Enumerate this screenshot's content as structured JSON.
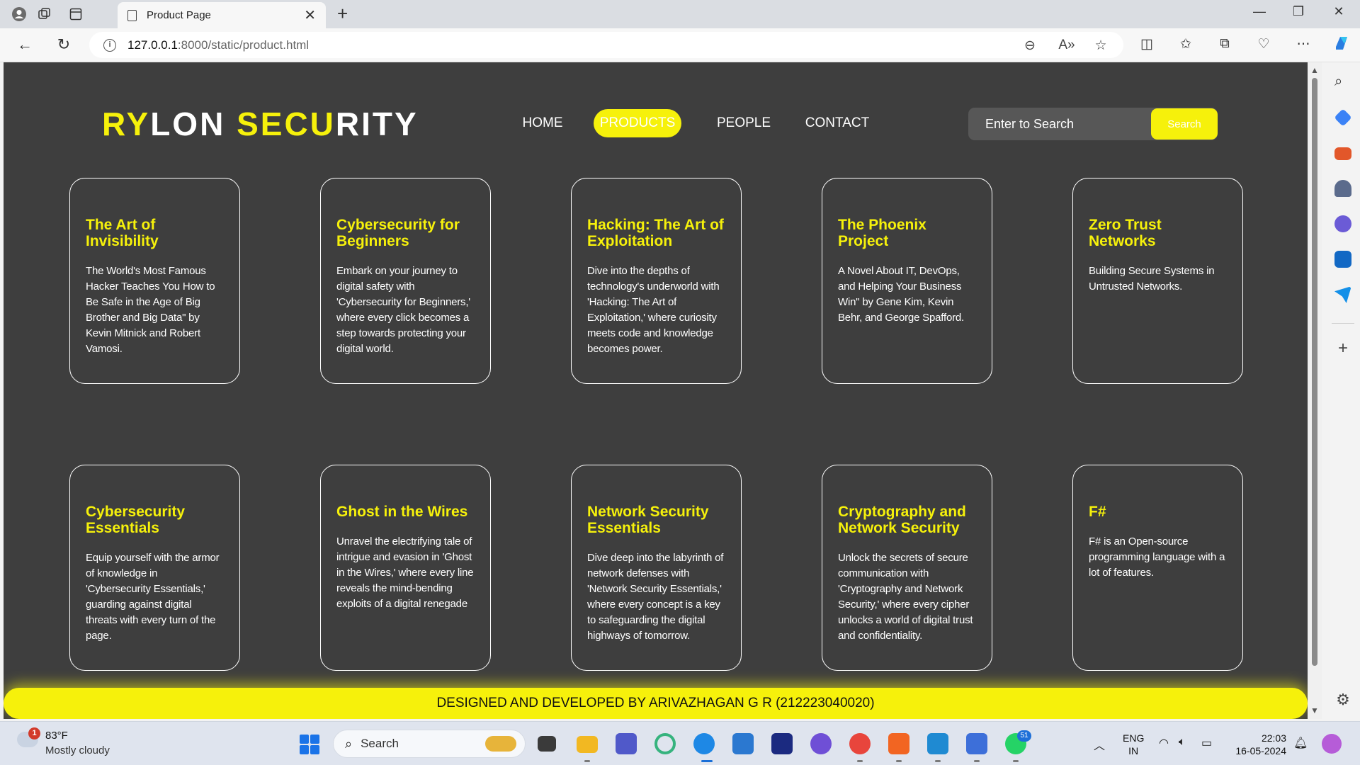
{
  "browser": {
    "tab_title": "Product Page",
    "url_host": "127.0.0.1",
    "url_path": ":8000/static/product.html"
  },
  "site": {
    "brand_parts": [
      {
        "text": "RY",
        "yellow": true
      },
      {
        "text": "LON ",
        "yellow": false
      },
      {
        "text": "SECU",
        "yellow": true
      },
      {
        "text": "RITY",
        "yellow": false
      }
    ],
    "nav": [
      {
        "label": "HOME",
        "active": false
      },
      {
        "label": "PRODUCTS",
        "active": true
      },
      {
        "label": "PEOPLE",
        "active": false
      },
      {
        "label": "CONTACT",
        "active": false
      }
    ],
    "search_placeholder": "Enter to Search",
    "search_button": "Search",
    "footer": "DESIGNED AND DEVELOPED BY ARIVAZHAGAN G R (212223040020)",
    "accent_color": "#f6f10b",
    "background_color": "#3e3e3e"
  },
  "products": [
    {
      "title": "The Art of Invisibility",
      "desc": "The World's Most Famous Hacker Teaches You How to Be Safe in the Age of Big Brother and Big Data\" by Kevin Mitnick and Robert Vamosi."
    },
    {
      "title": "Cybersecurity for Beginners",
      "desc": "Embark on your journey to digital safety with 'Cybersecurity for Beginners,' where every click becomes a step towards protecting your digital world."
    },
    {
      "title": "Hacking: The Art of Exploitation",
      "desc": "Dive into the depths of technology's underworld with 'Hacking: The Art of Exploitation,' where curiosity meets code and knowledge becomes power."
    },
    {
      "title": "The Phoenix Project",
      "desc": "A Novel About IT, DevOps, and Helping Your Business Win\" by Gene Kim, Kevin Behr, and George Spafford."
    },
    {
      "title": "Zero Trust Networks",
      "desc": "Building Secure Systems in Untrusted Networks."
    },
    {
      "title": "Cybersecurity Essentials",
      "desc": "Equip yourself with the armor of knowledge in 'Cybersecurity Essentials,' guarding against digital threats with every turn of the page."
    },
    {
      "title": "Ghost in the Wires",
      "desc": "Unravel the electrifying tale of intrigue and evasion in 'Ghost in the Wires,' where every line reveals the mind-bending exploits of a digital renegade"
    },
    {
      "title": "Network Security Essentials",
      "desc": "Dive deep into the labyrinth of network defenses with 'Network Security Essentials,' where every concept is a key to safeguarding the digital highways of tomorrow."
    },
    {
      "title": "Cryptography and Network Security",
      "desc": "Unlock the secrets of secure communication with 'Cryptography and Network Security,' where every cipher unlocks a world of digital trust and confidentiality."
    },
    {
      "title": "F#",
      "desc": "F# is an Open-source programming language with a lot of features."
    }
  ],
  "taskbar": {
    "weather_badge": "1",
    "temperature": "83°F",
    "condition": "Mostly cloudy",
    "search_label": "Search",
    "whatsapp_badge": "51",
    "lang_top": "ENG",
    "lang_bottom": "IN",
    "time": "22:03",
    "date": "16-05-2024"
  }
}
